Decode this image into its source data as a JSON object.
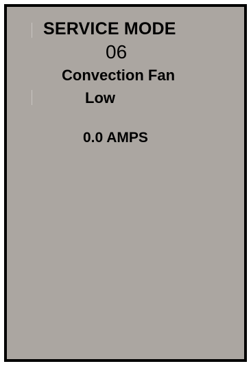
{
  "display": {
    "title": "SERVICE MODE",
    "mode_number": "06",
    "test_name": "Convection Fan",
    "test_setting": "Low",
    "reading": "0.0 AMPS"
  },
  "colors": {
    "screen_background": "#aba6a1",
    "text": "#000000",
    "border": "#000000"
  }
}
